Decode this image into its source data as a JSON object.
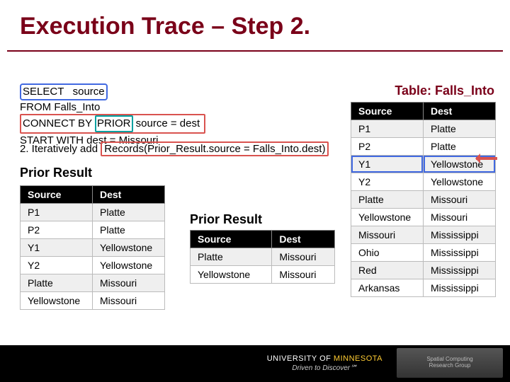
{
  "title": "Execution Trace – Step 2.",
  "sql": {
    "select": "SELECT",
    "source_col": "source",
    "from": "FROM      Falls_Into",
    "connect_pre": "CONNECT BY",
    "prior_kw": "PRIOR",
    "connect_post": "source = dest",
    "start": "START WITH dest = Missouri"
  },
  "step": {
    "prefix": "2. Iteratively add",
    "inner": "Records(Prior_Result.source = Falls_Into.dest)"
  },
  "prior_result_label": "Prior Result",
  "prior_result_label_2": "Prior Result",
  "table_right_label": "Table: Falls_Into",
  "headers": {
    "source": "Source",
    "dest": "Dest"
  },
  "left_rows": [
    {
      "s": "P1",
      "d": "Platte"
    },
    {
      "s": "P2",
      "d": "Platte"
    },
    {
      "s": "Y1",
      "d": "Yellowstone"
    },
    {
      "s": "Y2",
      "d": "Yellowstone"
    },
    {
      "s": "Platte",
      "d": "Missouri"
    },
    {
      "s": "Yellowstone",
      "d": "Missouri"
    }
  ],
  "mid_rows": [
    {
      "s": "Platte",
      "d": "Missouri"
    },
    {
      "s": "Yellowstone",
      "d": "Missouri"
    }
  ],
  "right_rows": [
    {
      "s": "P1",
      "d": "Platte"
    },
    {
      "s": "P2",
      "d": "Platte"
    },
    {
      "s": "Y1",
      "d": "Yellowstone"
    },
    {
      "s": "Y2",
      "d": "Yellowstone"
    },
    {
      "s": "Platte",
      "d": "Missouri"
    },
    {
      "s": "Yellowstone",
      "d": "Missouri"
    },
    {
      "s": "Missouri",
      "d": "Mississippi"
    },
    {
      "s": "Ohio",
      "d": "Mississippi"
    },
    {
      "s": "Red",
      "d": "Mississippi"
    },
    {
      "s": "Arkansas",
      "d": "Mississippi"
    }
  ],
  "footer": {
    "uni_pre": "UNIVERSITY OF",
    "uni_main": "MINNESOTA",
    "tag": "Driven to Discover℠",
    "logo1": "Spatial Computing",
    "logo2": "Research Group"
  }
}
